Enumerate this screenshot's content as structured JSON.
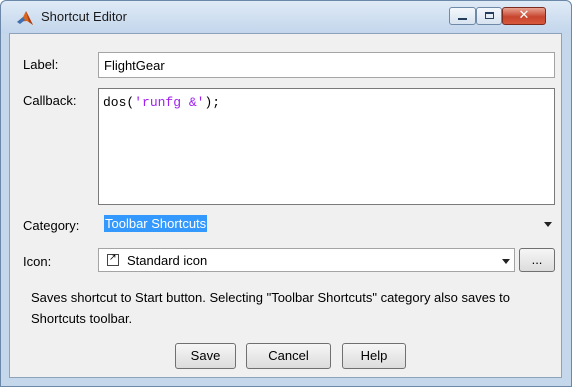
{
  "window": {
    "title": "Shortcut Editor",
    "close_glyph": "✕"
  },
  "form": {
    "label_caption": "Label:",
    "label_value": "FlightGear",
    "callback_caption": "Callback:",
    "callback_code_prefix": "dos(",
    "callback_code_string": "'runfg &'",
    "callback_code_suffix": ");",
    "category_caption": "Category:",
    "category_value": "Toolbar Shortcuts",
    "icon_caption": "Icon:",
    "icon_value": "Standard icon",
    "browse_label": "...",
    "description": "Saves shortcut to Start button. Selecting \"Toolbar Shortcuts\" category also saves to Shortcuts toolbar."
  },
  "buttons": {
    "save": "Save",
    "cancel": "Cancel",
    "help": "Help"
  },
  "colors": {
    "selection": "#3399ff",
    "code_string": "#a020f0",
    "title_bar": "#c3d6ec",
    "close_button": "#c7452e"
  }
}
